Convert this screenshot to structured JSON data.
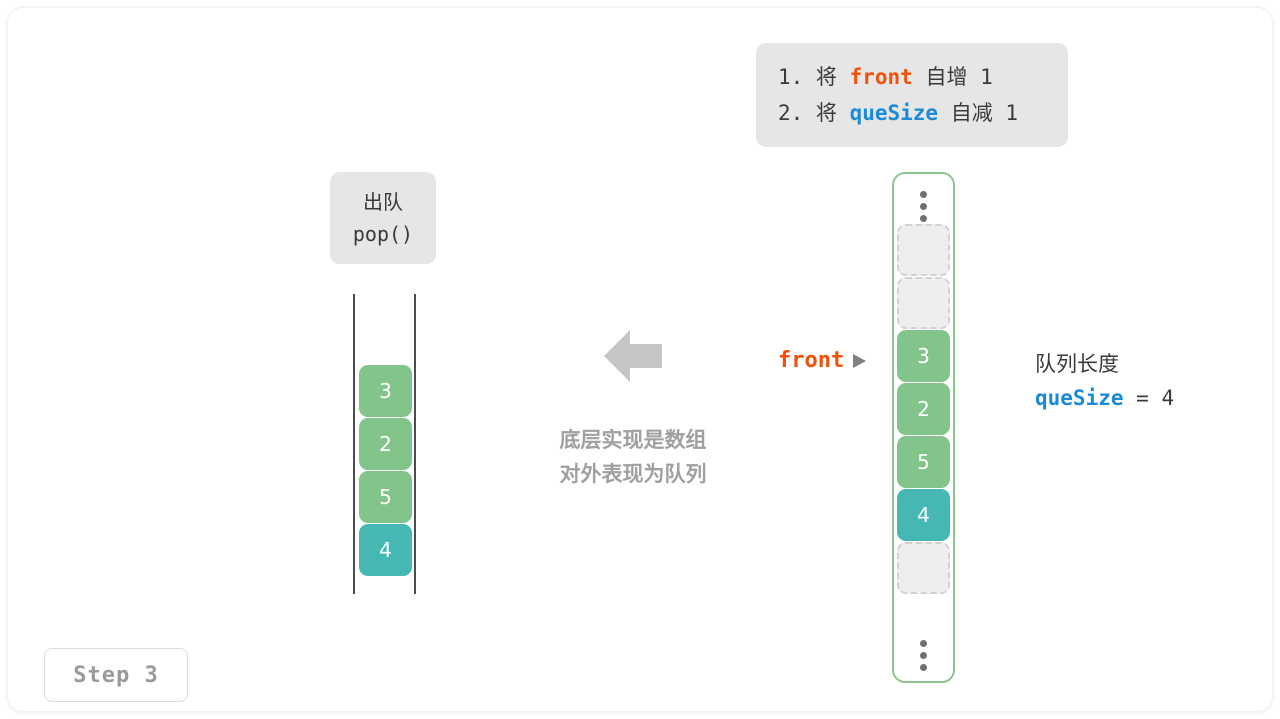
{
  "instruction": {
    "lines": [
      {
        "num": "1. 将 ",
        "keyword": "front",
        "keyword_kind": "front",
        "tail": " 自增 1"
      },
      {
        "num": "2. 将 ",
        "keyword": "queSize",
        "keyword_kind": "quesize",
        "tail": " 自减 1"
      }
    ]
  },
  "pop_box": {
    "line1": "出队",
    "line2": "pop()"
  },
  "left_queue": {
    "cells": [
      {
        "value": "3",
        "style": "green"
      },
      {
        "value": "2",
        "style": "green"
      },
      {
        "value": "5",
        "style": "green"
      },
      {
        "value": "4",
        "style": "teal"
      }
    ]
  },
  "right_array": {
    "dots_top": "vertical-ellipsis",
    "dots_bottom": "vertical-ellipsis",
    "cells": [
      {
        "value": "",
        "style": "empty"
      },
      {
        "value": "",
        "style": "empty"
      },
      {
        "value": "3",
        "style": "green"
      },
      {
        "value": "2",
        "style": "green"
      },
      {
        "value": "5",
        "style": "green"
      },
      {
        "value": "4",
        "style": "teal"
      },
      {
        "value": "",
        "style": "empty"
      }
    ]
  },
  "front_pointer": {
    "label": "front"
  },
  "queue_info": {
    "title": "队列长度",
    "var_name": "queSize",
    "equals": " = ",
    "value": "4"
  },
  "center": {
    "arrow": "left-arrow",
    "caption_line1": "底层实现是数组",
    "caption_line2": "对外表现为队列"
  },
  "step_badge": {
    "label": "Step 3"
  },
  "colors": {
    "green": "#83c48a",
    "teal": "#45b8b4",
    "empty_fill": "#eeeeee",
    "empty_border": "#d2d2d2",
    "front_orange": "#f1510a",
    "quesize_blue": "#1c8bd6",
    "callout_bg": "#e6e6e6",
    "container_border": "#8cc58f",
    "arrow_gray": "#c5c5c5",
    "caption_gray": "#a0a0a0"
  }
}
